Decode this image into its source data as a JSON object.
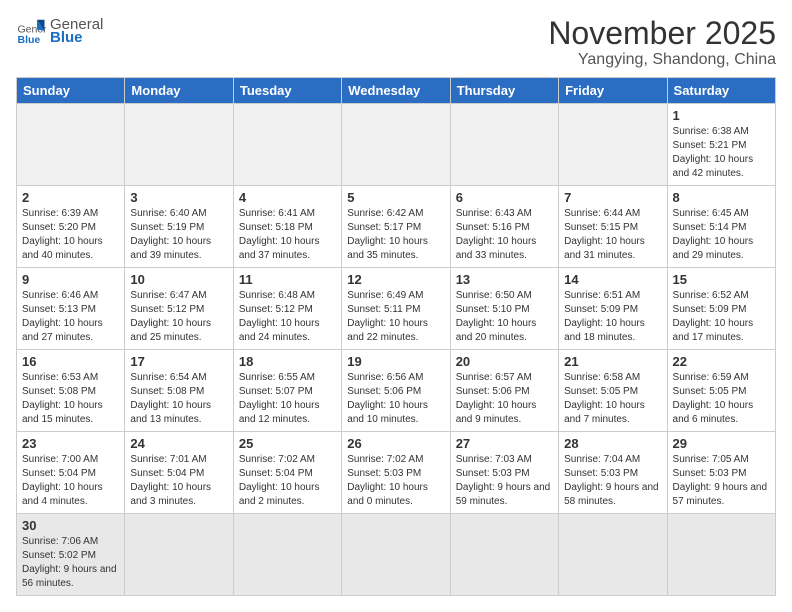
{
  "logo": {
    "text_general": "General",
    "text_blue": "Blue"
  },
  "header": {
    "month": "November 2025",
    "location": "Yangying, Shandong, China"
  },
  "weekdays": [
    "Sunday",
    "Monday",
    "Tuesday",
    "Wednesday",
    "Thursday",
    "Friday",
    "Saturday"
  ],
  "days": [
    {
      "num": "",
      "empty": true
    },
    {
      "num": "",
      "empty": true
    },
    {
      "num": "",
      "empty": true
    },
    {
      "num": "",
      "empty": true
    },
    {
      "num": "",
      "empty": true
    },
    {
      "num": "",
      "empty": true
    },
    {
      "num": "1",
      "sunrise": "6:38 AM",
      "sunset": "5:21 PM",
      "daylight": "10 hours and 42 minutes."
    },
    {
      "num": "2",
      "sunrise": "6:39 AM",
      "sunset": "5:20 PM",
      "daylight": "10 hours and 40 minutes."
    },
    {
      "num": "3",
      "sunrise": "6:40 AM",
      "sunset": "5:19 PM",
      "daylight": "10 hours and 39 minutes."
    },
    {
      "num": "4",
      "sunrise": "6:41 AM",
      "sunset": "5:18 PM",
      "daylight": "10 hours and 37 minutes."
    },
    {
      "num": "5",
      "sunrise": "6:42 AM",
      "sunset": "5:17 PM",
      "daylight": "10 hours and 35 minutes."
    },
    {
      "num": "6",
      "sunrise": "6:43 AM",
      "sunset": "5:16 PM",
      "daylight": "10 hours and 33 minutes."
    },
    {
      "num": "7",
      "sunrise": "6:44 AM",
      "sunset": "5:15 PM",
      "daylight": "10 hours and 31 minutes."
    },
    {
      "num": "8",
      "sunrise": "6:45 AM",
      "sunset": "5:14 PM",
      "daylight": "10 hours and 29 minutes."
    },
    {
      "num": "9",
      "sunrise": "6:46 AM",
      "sunset": "5:13 PM",
      "daylight": "10 hours and 27 minutes."
    },
    {
      "num": "10",
      "sunrise": "6:47 AM",
      "sunset": "5:12 PM",
      "daylight": "10 hours and 25 minutes."
    },
    {
      "num": "11",
      "sunrise": "6:48 AM",
      "sunset": "5:12 PM",
      "daylight": "10 hours and 24 minutes."
    },
    {
      "num": "12",
      "sunrise": "6:49 AM",
      "sunset": "5:11 PM",
      "daylight": "10 hours and 22 minutes."
    },
    {
      "num": "13",
      "sunrise": "6:50 AM",
      "sunset": "5:10 PM",
      "daylight": "10 hours and 20 minutes."
    },
    {
      "num": "14",
      "sunrise": "6:51 AM",
      "sunset": "5:09 PM",
      "daylight": "10 hours and 18 minutes."
    },
    {
      "num": "15",
      "sunrise": "6:52 AM",
      "sunset": "5:09 PM",
      "daylight": "10 hours and 17 minutes."
    },
    {
      "num": "16",
      "sunrise": "6:53 AM",
      "sunset": "5:08 PM",
      "daylight": "10 hours and 15 minutes."
    },
    {
      "num": "17",
      "sunrise": "6:54 AM",
      "sunset": "5:08 PM",
      "daylight": "10 hours and 13 minutes."
    },
    {
      "num": "18",
      "sunrise": "6:55 AM",
      "sunset": "5:07 PM",
      "daylight": "10 hours and 12 minutes."
    },
    {
      "num": "19",
      "sunrise": "6:56 AM",
      "sunset": "5:06 PM",
      "daylight": "10 hours and 10 minutes."
    },
    {
      "num": "20",
      "sunrise": "6:57 AM",
      "sunset": "5:06 PM",
      "daylight": "10 hours and 9 minutes."
    },
    {
      "num": "21",
      "sunrise": "6:58 AM",
      "sunset": "5:05 PM",
      "daylight": "10 hours and 7 minutes."
    },
    {
      "num": "22",
      "sunrise": "6:59 AM",
      "sunset": "5:05 PM",
      "daylight": "10 hours and 6 minutes."
    },
    {
      "num": "23",
      "sunrise": "7:00 AM",
      "sunset": "5:04 PM",
      "daylight": "10 hours and 4 minutes."
    },
    {
      "num": "24",
      "sunrise": "7:01 AM",
      "sunset": "5:04 PM",
      "daylight": "10 hours and 3 minutes."
    },
    {
      "num": "25",
      "sunrise": "7:02 AM",
      "sunset": "5:04 PM",
      "daylight": "10 hours and 2 minutes."
    },
    {
      "num": "26",
      "sunrise": "7:02 AM",
      "sunset": "5:03 PM",
      "daylight": "10 hours and 0 minutes."
    },
    {
      "num": "27",
      "sunrise": "7:03 AM",
      "sunset": "5:03 PM",
      "daylight": "9 hours and 59 minutes."
    },
    {
      "num": "28",
      "sunrise": "7:04 AM",
      "sunset": "5:03 PM",
      "daylight": "9 hours and 58 minutes."
    },
    {
      "num": "29",
      "sunrise": "7:05 AM",
      "sunset": "5:03 PM",
      "daylight": "9 hours and 57 minutes."
    },
    {
      "num": "30",
      "sunrise": "7:06 AM",
      "sunset": "5:02 PM",
      "daylight": "9 hours and 56 minutes."
    }
  ]
}
